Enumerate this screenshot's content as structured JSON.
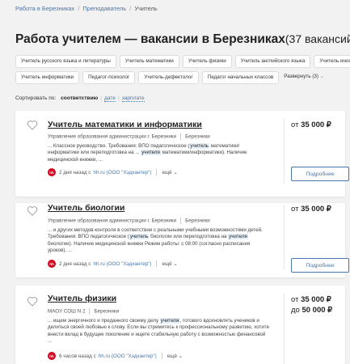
{
  "breadcrumb": {
    "items": [
      "Работа в Березниках",
      "Преподаватель",
      "Учитель"
    ],
    "separator": "/"
  },
  "header": {
    "title": "Работа учителем — вакансии в Березниках",
    "count": "(37 вакансий)"
  },
  "tags": {
    "row1": [
      "Учитель русского языка и литературы",
      "Учитель математики",
      "Учитель физики",
      "Учитель английского языка",
      "Учитель иностр"
    ],
    "row2": [
      "Учитель информатики",
      "Педагог-психолог",
      "Учитель-дефектолог",
      "Педагог начальных классов"
    ],
    "expand_label": "Развернуть (3)"
  },
  "sort": {
    "label": "Сортировать по:",
    "options": [
      "соответствию",
      "дате",
      "зарплате"
    ]
  },
  "vacancies": [
    {
      "title": "Учитель математики и информатики",
      "company": "Управление образования администрации г. Березники",
      "city": "Березники",
      "desc_parts": [
        "... Классное руководство. Требования: ВПО педагогическое (",
        "учитель",
        " математики/ информатики или переподготовка на ... ",
        "учителя",
        " математики/информатики). Наличие медицинской книжки, ..."
      ],
      "time": "2 дня назад с",
      "source": "hh.ru (ООО \"Хэдхантер\")",
      "more": "ещё",
      "salary_from_prefix": "от",
      "salary_from": "35 000",
      "currency": "₽",
      "button": "Подробнее"
    },
    {
      "title": "Учитель биологии",
      "company": "Управление образования администрации г. Березники",
      "city": "Березники",
      "desc_parts": [
        "... и других методов контроля в соответствии с реальными учебными возможностями детей. Требования: ВПО педагогическое (",
        "учитель",
        " биологии или переподготовка на ",
        "учителя",
        " биологии). Наличие медицинской книжки Режим работы: с 08:00 (согласно расписания уроков), ..."
      ],
      "time": "2 дня назад с",
      "source": "hh.ru (ООО \"Хэдхантер\")",
      "more": "ещё",
      "salary_from_prefix": "от",
      "salary_from": "35 000",
      "currency": "₽",
      "button": "Подробнее"
    },
    {
      "title": "Учитель физики",
      "company": "МАОУ СОШ N 2",
      "city": "Березники",
      "desc_parts": [
        "... ищем энергичного и преданного своему делу ",
        "учителя",
        ", готового вдохновлять учеников и делиться своей любовью к слову. Если вы стремитесь к профессиональному развитию, хотите внести вклад в будущее поколение и ищете стабильную работу с возможностью финансовой ..."
      ],
      "time": "6 часов назад с",
      "source": "hh.ru (ООО \"Хэдхантер\")",
      "more": "ещё",
      "salary_from_prefix": "от",
      "salary_from": "35 000",
      "salary_to_prefix": "до",
      "salary_to": "50 000",
      "currency": "₽"
    }
  ],
  "icons": {
    "favorite": "heart-outline-icon",
    "source_logo": "hh-logo-icon",
    "more_chevron": "chevron-down-icon"
  },
  "colors": {
    "link": "#4a76a8",
    "hh_red": "#d6001c",
    "highlight": "#e6f0f8"
  }
}
